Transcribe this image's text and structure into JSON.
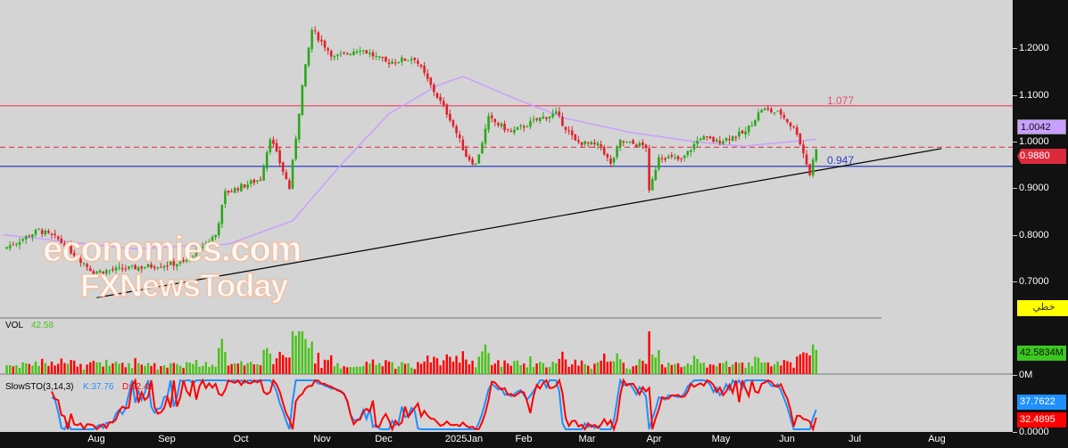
{
  "chart_data": {
    "type": "candlestick",
    "price_axis": {
      "ticks": [
        "1.2000",
        "1.1000",
        "1.0000",
        "0.9000",
        "0.8000",
        "0.7000"
      ],
      "values": [
        1.2,
        1.1,
        1.0,
        0.9,
        0.8,
        0.7
      ]
    },
    "months": [
      "Aug",
      "Sep",
      "Oct",
      "Nov",
      "Dec",
      "2025Jan",
      "Feb",
      "Mar",
      "Apr",
      "May",
      "Jun",
      "Jul",
      "Aug"
    ],
    "price_keypoints": [
      [
        0,
        0.77
      ],
      [
        11,
        0.81
      ],
      [
        17,
        0.79
      ],
      [
        28,
        0.72
      ],
      [
        42,
        0.73
      ],
      [
        56,
        0.74
      ],
      [
        66,
        0.8
      ],
      [
        69,
        0.89
      ],
      [
        80,
        0.92
      ],
      [
        83,
        1.01
      ],
      [
        89,
        0.9
      ],
      [
        93,
        1.12
      ],
      [
        96,
        1.24
      ],
      [
        103,
        1.18
      ],
      [
        111,
        1.2
      ],
      [
        119,
        1.17
      ],
      [
        128,
        1.18
      ],
      [
        133,
        1.12
      ],
      [
        139,
        1.05
      ],
      [
        144,
        0.97
      ],
      [
        147,
        0.95
      ],
      [
        151,
        1.05
      ],
      [
        158,
        1.02
      ],
      [
        167,
        1.05
      ],
      [
        172,
        1.06
      ],
      [
        178,
        1.0
      ],
      [
        186,
        0.99
      ],
      [
        189,
        0.95
      ],
      [
        192,
        1.0
      ],
      [
        200,
        0.99
      ],
      [
        201,
        0.89
      ],
      [
        204,
        0.97
      ],
      [
        211,
        0.96
      ],
      [
        217,
        1.01
      ],
      [
        222,
        1.0
      ],
      [
        231,
        1.02
      ],
      [
        236,
        1.07
      ],
      [
        242,
        1.06
      ],
      [
        247,
        1.02
      ],
      [
        251,
        0.93
      ],
      [
        253,
        0.988
      ]
    ],
    "ma_keypoints": [
      [
        0,
        0.8
      ],
      [
        40,
        0.77
      ],
      [
        70,
        0.78
      ],
      [
        90,
        0.83
      ],
      [
        105,
        0.95
      ],
      [
        120,
        1.06
      ],
      [
        135,
        1.12
      ],
      [
        143,
        1.14
      ],
      [
        160,
        1.09
      ],
      [
        175,
        1.05
      ],
      [
        195,
        1.02
      ],
      [
        215,
        1.0
      ],
      [
        230,
        0.99
      ],
      [
        245,
        1.0
      ],
      [
        253,
        1.005
      ]
    ],
    "hlines": [
      {
        "label": "1.077",
        "value": 1.077,
        "color": "#e8506a"
      },
      {
        "label": "0.947",
        "value": 0.947,
        "color": "#2b3fbf"
      }
    ],
    "current_price": {
      "label": "0.9880",
      "value": 0.988,
      "color": "#dc2a3c"
    },
    "ma_value": {
      "label": "1.0042",
      "color": "#c9a0ff"
    },
    "trendline": {
      "from": [
        29,
        0.665
      ],
      "to": [
        292,
        0.985
      ]
    },
    "volume": {
      "title": "VOL",
      "value": "42.58",
      "axis_value": "42.5834M",
      "zero": "0M"
    },
    "stochastic": {
      "title": "SlowSTO(3,14,3)",
      "k": "K:37.76",
      "d": "D:32.49",
      "k_axis": "37.7622",
      "d_axis": "32.4895",
      "zero": "0.0000",
      "k_color": "#1e90ff",
      "d_color": "#ff0000"
    },
    "chart_type_button": "خطي"
  },
  "watermark": {
    "line1": "economies.com",
    "line2": "FXNewsToday"
  }
}
